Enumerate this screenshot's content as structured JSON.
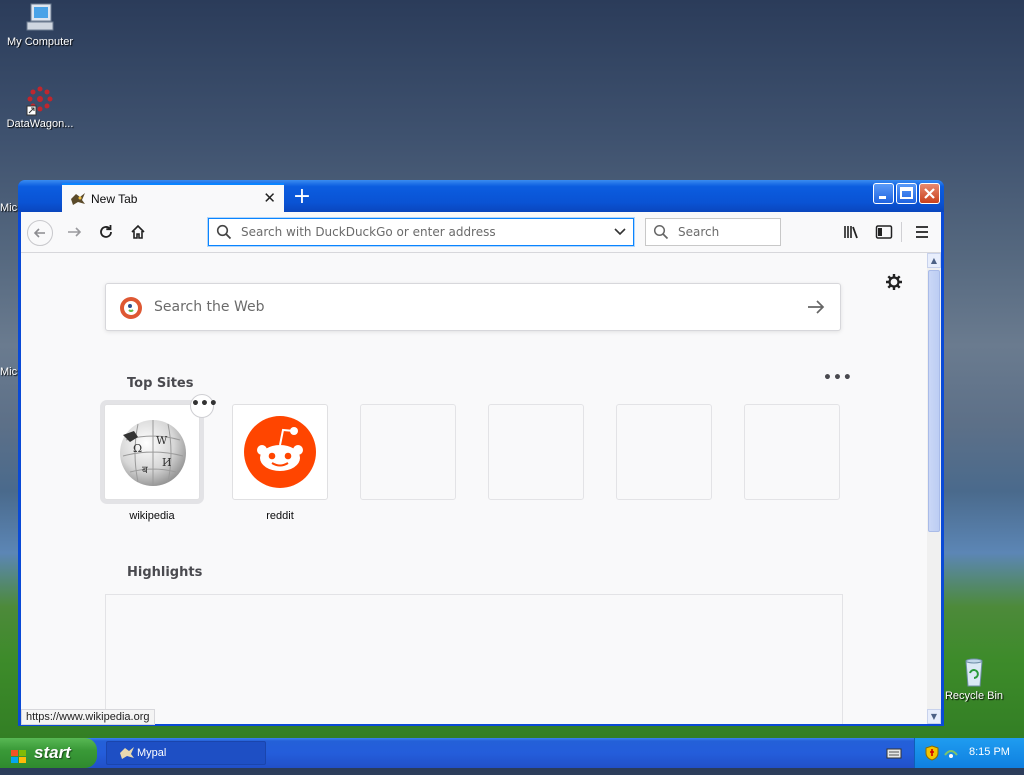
{
  "desktop": {
    "icons": [
      {
        "label": "My Computer"
      },
      {
        "label": "DataWagon..."
      },
      {
        "label": "Recycle Bin"
      }
    ],
    "clipped_labels": [
      "Mic",
      "Mic"
    ]
  },
  "browser": {
    "tab": {
      "title": "New Tab",
      "close": "✕"
    },
    "new_tab": "+",
    "window_buttons": {
      "minimize": "_",
      "maximize": "□",
      "close": "✕"
    },
    "urlbar": {
      "placeholder": "Search with DuckDuckGo or enter address"
    },
    "searchbar": {
      "placeholder": "Search"
    },
    "newtab": {
      "search": {
        "placeholder": "Search the Web"
      },
      "top_sites_title": "Top Sites",
      "top_sites": [
        {
          "label": "wikipedia"
        },
        {
          "label": "reddit"
        }
      ],
      "more": "•••",
      "tile_menu": "•••",
      "highlights_title": "Highlights"
    },
    "status_url": "https://www.wikipedia.org"
  },
  "taskbar": {
    "start": "start",
    "task": "Mypal",
    "clock": "8:15 PM"
  },
  "colors": {
    "accent": "#0a84ff",
    "ddg": "#de5833",
    "reddit": "#ff4500",
    "xp_blue": "#245ddb",
    "start_green": "#3a9a38"
  }
}
